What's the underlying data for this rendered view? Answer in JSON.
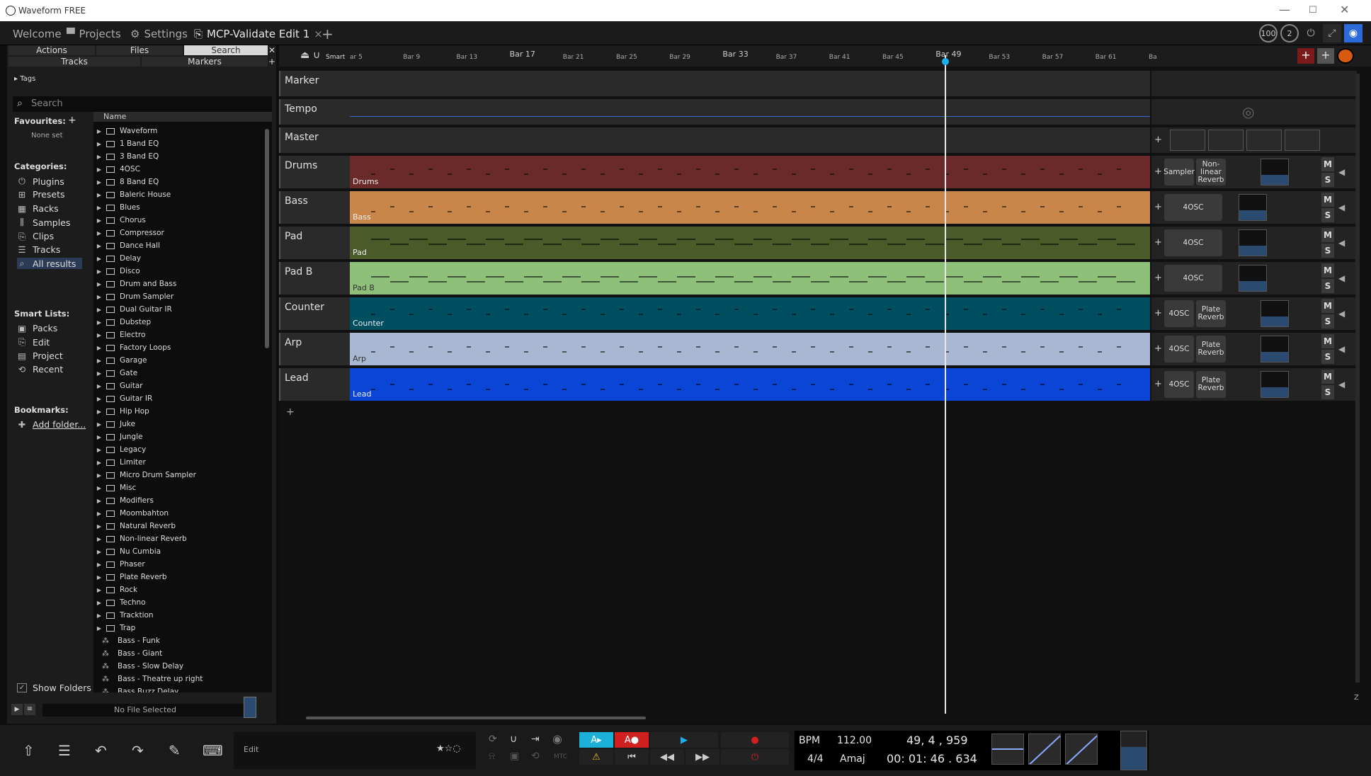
{
  "window": {
    "title": "Waveform FREE",
    "controls": [
      "—",
      "☐",
      "✕"
    ]
  },
  "tabs": [
    {
      "label": "Welcome",
      "icon": ""
    },
    {
      "label": "Projects",
      "icon": "folder-icon"
    },
    {
      "label": "Settings",
      "icon": "gear-icon"
    },
    {
      "label": "MCP-Validate Edit 1",
      "icon": "edit-icon"
    }
  ],
  "tab_close": "×",
  "tab_add": "+",
  "top_right": {
    "cpu": "100",
    "voices": "2"
  },
  "left": {
    "row1": [
      "Actions",
      "Files",
      "Search"
    ],
    "row2": [
      "Tracks",
      "Markers"
    ],
    "tags": "Tags",
    "search_placeholder": "Search",
    "favourites": "Favourites:",
    "none_set": "None set",
    "categories_label": "Categories:",
    "categories": [
      "Plugins",
      "Presets",
      "Racks",
      "Samples",
      "Clips",
      "Tracks",
      "All results"
    ],
    "smart_lists_label": "Smart Lists:",
    "smart_lists": [
      "Packs",
      "Edit",
      "Project",
      "Recent"
    ],
    "bookmarks_label": "Bookmarks:",
    "add_folder": "Add folder...",
    "show_folders": "Show Folders",
    "column_name": "Name",
    "folders": [
      "Waveform",
      "1 Band EQ",
      "3 Band EQ",
      "4OSC",
      "8 Band EQ",
      "Baleric House",
      "Blues",
      "Chorus",
      "Compressor",
      "Dance Hall",
      "Delay",
      "Disco",
      "Drum and Bass",
      "Drum Sampler",
      "Dual Guitar IR",
      "Dubstep",
      "Electro",
      "Factory Loops",
      "Garage",
      "Gate",
      "Guitar",
      "Guitar IR",
      "Hip Hop",
      "Juke",
      "Jungle",
      "Legacy",
      "Limiter",
      "Micro Drum Sampler",
      "Misc",
      "Modifiers",
      "Moombahton",
      "Natural Reverb",
      "Non-linear Reverb",
      "Nu Cumbia",
      "Phaser",
      "Plate Reverb",
      "Rock",
      "Techno",
      "Tracktion",
      "Trap"
    ],
    "files": [
      "Bass - Funk",
      "Bass - Giant",
      "Bass - Slow Delay",
      "Bass - Theatre up right",
      "Bass Buzz Delay"
    ],
    "no_file": "No File Selected"
  },
  "ruler": {
    "smart": "Smart",
    "marks": [
      {
        "t": "ar 5",
        "big": false
      },
      {
        "t": "Bar 9",
        "big": false
      },
      {
        "t": "Bar 13",
        "big": false
      },
      {
        "t": "Bar 17",
        "big": true
      },
      {
        "t": "Bar 21",
        "big": false
      },
      {
        "t": "Bar 25",
        "big": false
      },
      {
        "t": "Bar 29",
        "big": false
      },
      {
        "t": "Bar 33",
        "big": true
      },
      {
        "t": "Bar 37",
        "big": false
      },
      {
        "t": "Bar 41",
        "big": false
      },
      {
        "t": "Bar 45",
        "big": false
      },
      {
        "t": "Bar 49",
        "big": true
      },
      {
        "t": "Bar 53",
        "big": false
      },
      {
        "t": "Bar 57",
        "big": false
      },
      {
        "t": "Bar 61",
        "big": false
      },
      {
        "t": "Ba",
        "big": false
      }
    ]
  },
  "tracks": [
    {
      "name": "Marker",
      "clip": "",
      "color": "#2a2a2a",
      "plugins": []
    },
    {
      "name": "Tempo",
      "clip": "",
      "color": "#2a2a2a",
      "plugins": []
    },
    {
      "name": "Master",
      "clip": "",
      "color": "#2a2a2a",
      "plugins": []
    },
    {
      "name": "Drums",
      "clip": "Drums",
      "color": "#6a2a2a",
      "plugins": [
        "Sampler",
        "Non-linear Reverb"
      ]
    },
    {
      "name": "Bass",
      "clip": "Bass",
      "color": "#c8864a",
      "plugins": [
        "4OSC"
      ]
    },
    {
      "name": "Pad",
      "clip": "Pad",
      "color": "#4a5a28",
      "plugins": [
        "4OSC"
      ]
    },
    {
      "name": "Pad B",
      "clip": "Pad B",
      "color": "#8fc07a",
      "plugins": [
        "4OSC"
      ]
    },
    {
      "name": "Counter",
      "clip": "Counter",
      "color": "#004f60",
      "plugins": [
        "4OSC",
        "Plate Reverb"
      ]
    },
    {
      "name": "Arp",
      "clip": "Arp",
      "color": "#a9b8d2",
      "plugins": [
        "4OSC",
        "Plate Reverb"
      ]
    },
    {
      "name": "Lead",
      "clip": "Lead",
      "color": "#0a45d6",
      "plugins": [
        "4OSC",
        "Plate Reverb"
      ]
    }
  ],
  "mute": "M",
  "solo": "S",
  "transport": {
    "edit": "Edit",
    "bpm_label": "BPM",
    "bpm": "112.00",
    "sig": "4/4",
    "key": "Amaj",
    "pos": "49, 4 , 959",
    "time": "00: 01: 46 . 634",
    "mtc": "MTC",
    "zoom": "Z"
  }
}
